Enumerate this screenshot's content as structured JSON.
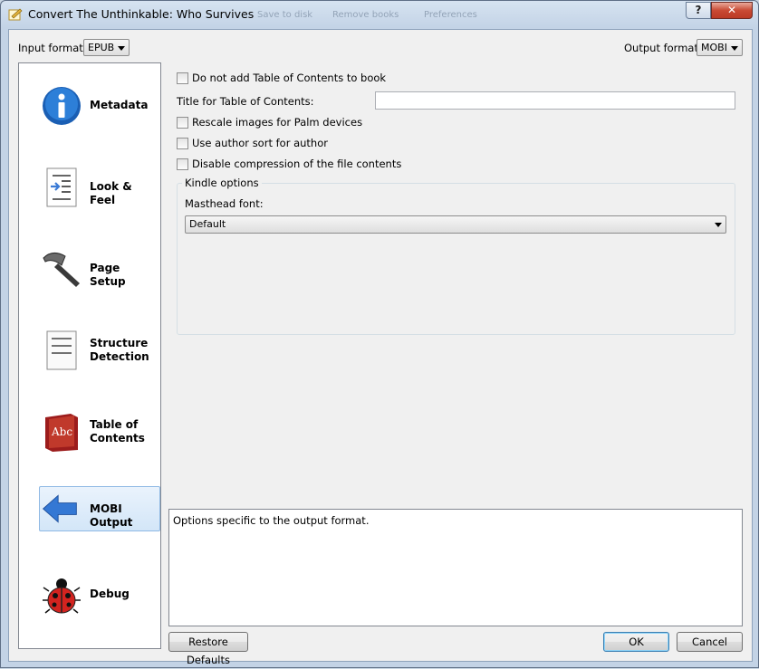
{
  "window": {
    "title": "Convert The Unthinkable: Who Survives",
    "background_toolbar_ghost": [
      "Save to disk",
      "Remove books",
      "Preferences"
    ],
    "help_label": "?",
    "close_label": "✕"
  },
  "formats": {
    "input_label": "Input format:",
    "input_value": "EPUB",
    "output_label": "Output format:",
    "output_value": "MOBI"
  },
  "sidebar": {
    "items": [
      {
        "label": "Metadata",
        "icon": "info-icon"
      },
      {
        "label": "Look & Feel",
        "icon": "indent-document-icon"
      },
      {
        "label": "Page Setup",
        "icon": "hammer-icon"
      },
      {
        "label": "Structure Detection",
        "icon": "document-lines-icon"
      },
      {
        "label": "Table of Contents",
        "icon": "red-book-icon"
      },
      {
        "label": "MOBI Output",
        "icon": "blue-left-arrow-icon",
        "selected": true
      },
      {
        "label": "Debug",
        "icon": "ladybug-icon"
      }
    ]
  },
  "options": {
    "no_toc": "Do not add Table of Contents to book",
    "toc_title_label": "Title for Table of Contents:",
    "toc_title_value": "",
    "rescale_images": "Rescale images for Palm devices",
    "author_sort": "Use author sort for author",
    "disable_compression": "Disable compression of the file contents",
    "kindle_group_title": "Kindle options",
    "masthead_font_label": "Masthead font:",
    "masthead_font_value": "Default"
  },
  "description": "Options specific to the output format.",
  "buttons": {
    "restore_defaults": "Restore Defaults",
    "ok": "OK",
    "cancel": "Cancel"
  },
  "colors": {
    "selection_bg": "#d3e6f8",
    "selection_border": "#8fb9e4",
    "close_button": "#c94a34",
    "default_button_border": "#3c7fb1"
  }
}
